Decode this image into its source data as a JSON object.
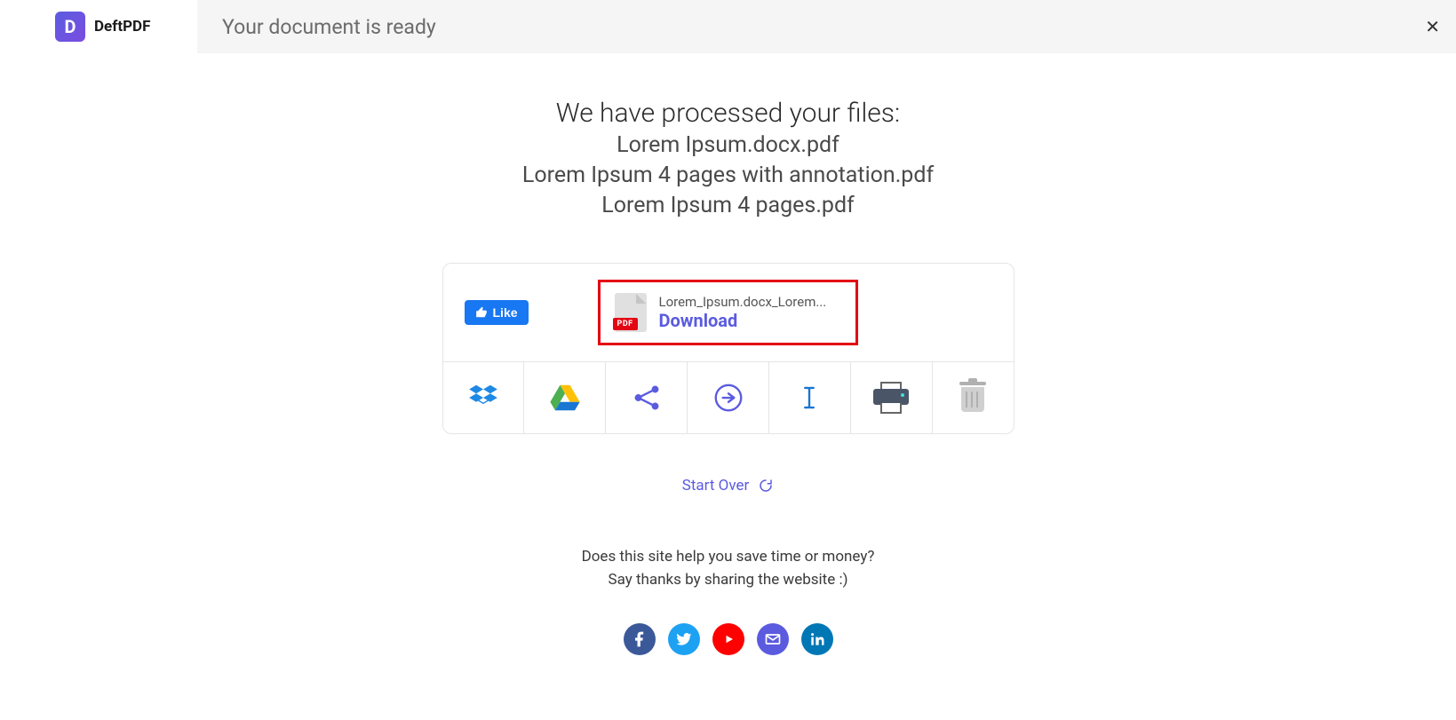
{
  "brand": {
    "initial": "D",
    "name": "DeftPDF"
  },
  "header": {
    "readyText": "Your document is ready"
  },
  "processed": {
    "title": "We have processed your files:",
    "files": [
      "Lorem Ipsum.docx.pdf",
      "Lorem Ipsum 4 pages with annotation.pdf",
      "Lorem Ipsum 4 pages.pdf"
    ]
  },
  "like": {
    "label": "Like"
  },
  "download": {
    "filename": "Lorem_Ipsum.docx_Lorem...",
    "label": "Download",
    "badge": "PDF"
  },
  "actions": {
    "dropbox": "dropbox",
    "gdrive": "google-drive",
    "share": "share",
    "continue": "continue",
    "rename": "rename",
    "print": "print",
    "delete": "delete"
  },
  "startOver": "Start Over",
  "thanks": {
    "line1": "Does this site help you save time or money?",
    "line2": "Say thanks by sharing the website :)"
  }
}
